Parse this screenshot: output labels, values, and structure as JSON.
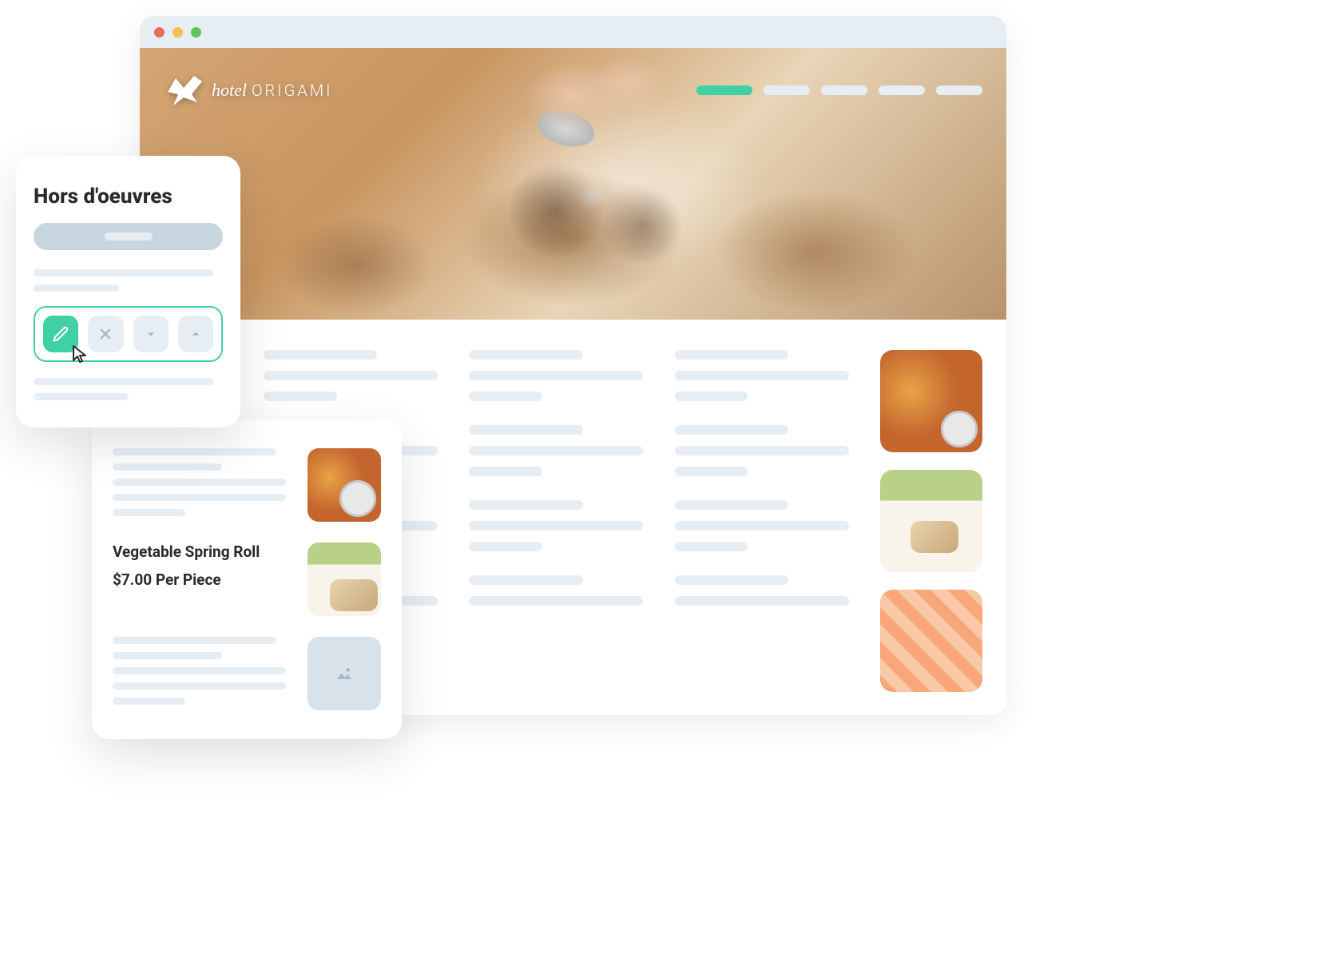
{
  "browser": {
    "logo": {
      "hotel": "hotel",
      "origami": "ORIGAMI"
    },
    "nav_count": 5
  },
  "editor": {
    "title": "Hors d'oeuvres",
    "toolbar": {
      "edit": "edit",
      "close": "close",
      "down": "move-down",
      "up": "move-up"
    }
  },
  "mobile": {
    "item": {
      "name": "Vegetable Spring Roll",
      "price": "$7.00 Per Piece"
    }
  },
  "colors": {
    "accent": "#3fd0a3",
    "placeholder": "#e7eef3"
  }
}
